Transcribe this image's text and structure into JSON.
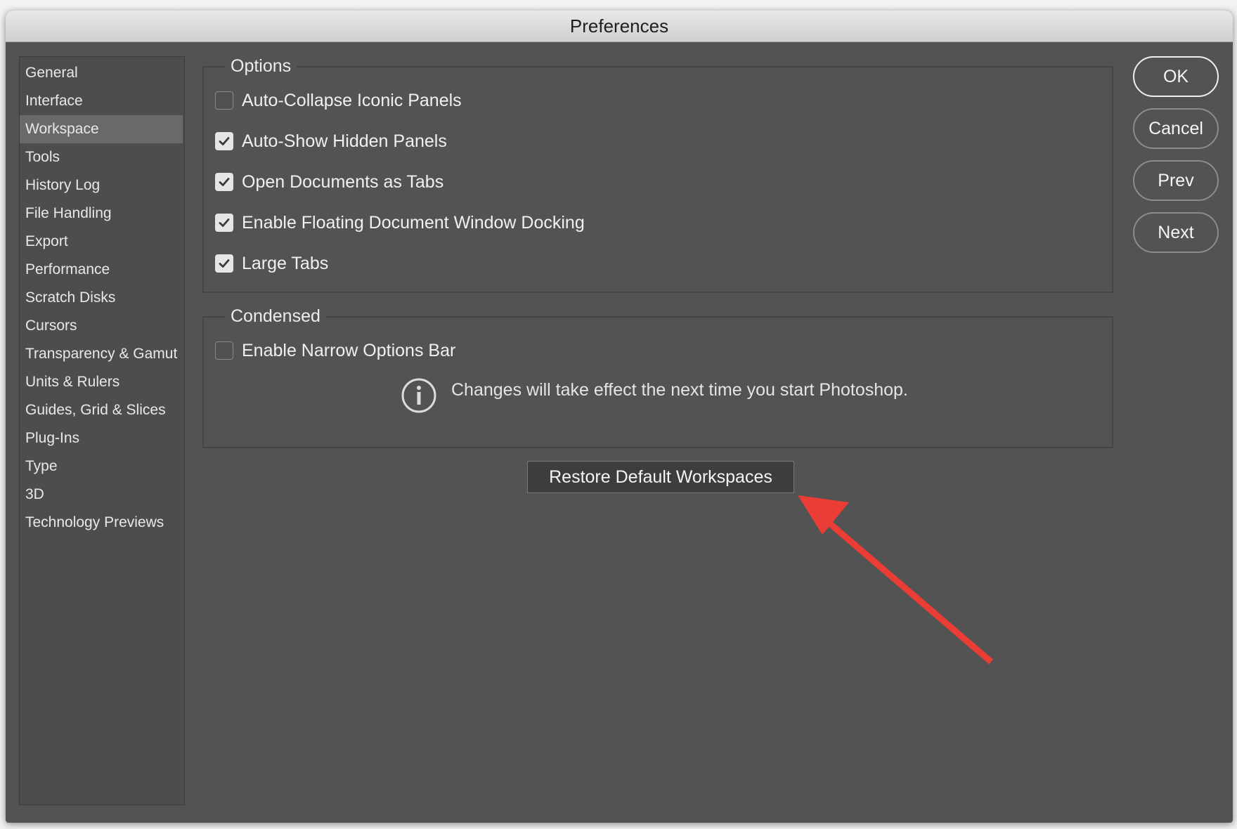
{
  "window": {
    "title": "Preferences"
  },
  "sidebar": {
    "items": [
      {
        "label": "General",
        "selected": false
      },
      {
        "label": "Interface",
        "selected": false
      },
      {
        "label": "Workspace",
        "selected": true
      },
      {
        "label": "Tools",
        "selected": false
      },
      {
        "label": "History Log",
        "selected": false
      },
      {
        "label": "File Handling",
        "selected": false
      },
      {
        "label": "Export",
        "selected": false
      },
      {
        "label": "Performance",
        "selected": false
      },
      {
        "label": "Scratch Disks",
        "selected": false
      },
      {
        "label": "Cursors",
        "selected": false
      },
      {
        "label": "Transparency & Gamut",
        "selected": false
      },
      {
        "label": "Units & Rulers",
        "selected": false
      },
      {
        "label": "Guides, Grid & Slices",
        "selected": false
      },
      {
        "label": "Plug-Ins",
        "selected": false
      },
      {
        "label": "Type",
        "selected": false
      },
      {
        "label": "3D",
        "selected": false
      },
      {
        "label": "Technology Previews",
        "selected": false
      }
    ]
  },
  "options": {
    "legend": "Options",
    "items": [
      {
        "label": "Auto-Collapse Iconic Panels",
        "checked": false
      },
      {
        "label": "Auto-Show Hidden Panels",
        "checked": true
      },
      {
        "label": "Open Documents as Tabs",
        "checked": true
      },
      {
        "label": "Enable Floating Document Window Docking",
        "checked": true
      },
      {
        "label": "Large Tabs",
        "checked": true
      }
    ]
  },
  "condensed": {
    "legend": "Condensed",
    "items": [
      {
        "label": "Enable Narrow Options Bar",
        "checked": false
      }
    ],
    "info_icon": "info-circle-icon",
    "info_text": "Changes will take effect the next time you start Photoshop."
  },
  "restore_button": {
    "label": "Restore Default Workspaces"
  },
  "dialog_buttons": {
    "ok": "OK",
    "cancel": "Cancel",
    "prev": "Prev",
    "next": "Next"
  },
  "colors": {
    "window_bg": "#535353",
    "annotation_arrow": "#ea3d35"
  }
}
